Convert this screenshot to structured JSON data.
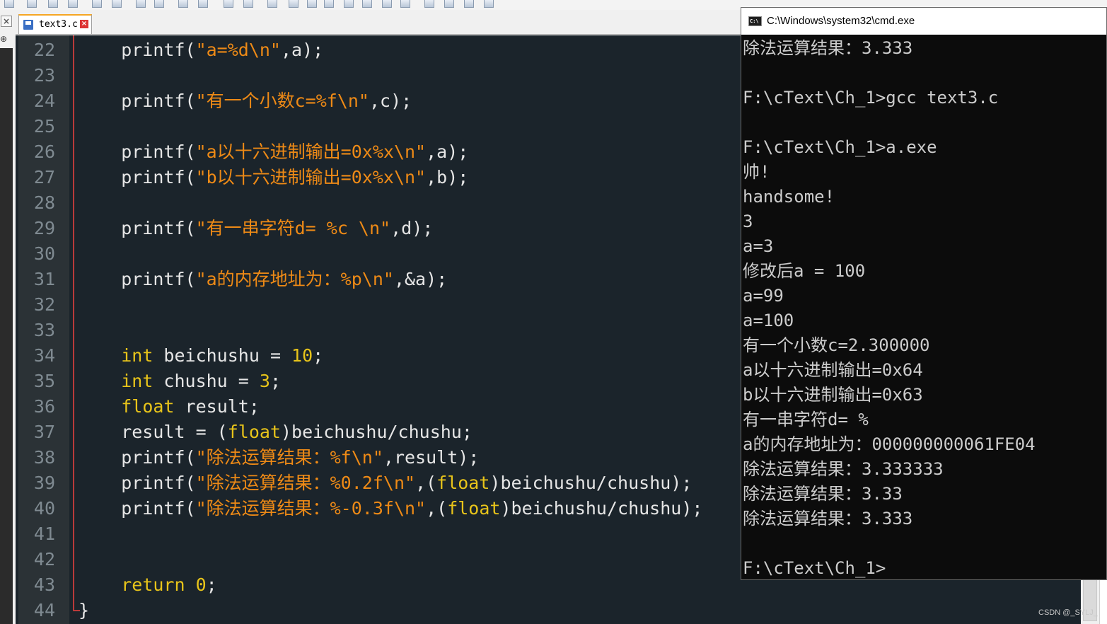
{
  "editor": {
    "tab_label": "text3.c",
    "lines": [
      {
        "num": "22",
        "tokens": [
          {
            "t": "    printf(",
            "c": "t"
          },
          {
            "t": "\"a=%d\\n\"",
            "c": "s"
          },
          {
            "t": ",a);",
            "c": "t"
          }
        ]
      },
      {
        "num": "23",
        "tokens": []
      },
      {
        "num": "24",
        "tokens": [
          {
            "t": "    printf(",
            "c": "t"
          },
          {
            "t": "\"有一个小数c=%f\\n\"",
            "c": "s"
          },
          {
            "t": ",c);",
            "c": "t"
          }
        ]
      },
      {
        "num": "25",
        "tokens": []
      },
      {
        "num": "26",
        "tokens": [
          {
            "t": "    printf(",
            "c": "t"
          },
          {
            "t": "\"a以十六进制输出=0x%x\\n\"",
            "c": "s"
          },
          {
            "t": ",a);",
            "c": "t"
          }
        ]
      },
      {
        "num": "27",
        "tokens": [
          {
            "t": "    printf(",
            "c": "t"
          },
          {
            "t": "\"b以十六进制输出=0x%x\\n\"",
            "c": "s"
          },
          {
            "t": ",b);",
            "c": "t"
          }
        ]
      },
      {
        "num": "28",
        "tokens": []
      },
      {
        "num": "29",
        "tokens": [
          {
            "t": "    printf(",
            "c": "t"
          },
          {
            "t": "\"有一串字符d= %c \\n\"",
            "c": "s"
          },
          {
            "t": ",d);",
            "c": "t"
          }
        ]
      },
      {
        "num": "30",
        "tokens": []
      },
      {
        "num": "31",
        "tokens": [
          {
            "t": "    printf(",
            "c": "t"
          },
          {
            "t": "\"a的内存地址为：%p\\n\"",
            "c": "s"
          },
          {
            "t": ",&a);",
            "c": "t"
          }
        ]
      },
      {
        "num": "32",
        "tokens": []
      },
      {
        "num": "33",
        "tokens": []
      },
      {
        "num": "34",
        "tokens": [
          {
            "t": "    ",
            "c": "t"
          },
          {
            "t": "int",
            "c": "k"
          },
          {
            "t": " beichushu = ",
            "c": "t"
          },
          {
            "t": "10",
            "c": "n"
          },
          {
            "t": ";",
            "c": "t"
          }
        ]
      },
      {
        "num": "35",
        "tokens": [
          {
            "t": "    ",
            "c": "t"
          },
          {
            "t": "int",
            "c": "k"
          },
          {
            "t": " chushu = ",
            "c": "t"
          },
          {
            "t": "3",
            "c": "n"
          },
          {
            "t": ";",
            "c": "t"
          }
        ]
      },
      {
        "num": "36",
        "tokens": [
          {
            "t": "    ",
            "c": "t"
          },
          {
            "t": "float",
            "c": "k"
          },
          {
            "t": " result;",
            "c": "t"
          }
        ]
      },
      {
        "num": "37",
        "tokens": [
          {
            "t": "    result = (",
            "c": "t"
          },
          {
            "t": "float",
            "c": "k"
          },
          {
            "t": ")beichushu/chushu;",
            "c": "t"
          }
        ]
      },
      {
        "num": "38",
        "tokens": [
          {
            "t": "    printf(",
            "c": "t"
          },
          {
            "t": "\"除法运算结果：%f\\n\"",
            "c": "s"
          },
          {
            "t": ",result);",
            "c": "t"
          }
        ]
      },
      {
        "num": "39",
        "tokens": [
          {
            "t": "    printf(",
            "c": "t"
          },
          {
            "t": "\"除法运算结果：%0.2f\\n\"",
            "c": "s"
          },
          {
            "t": ",(",
            "c": "t"
          },
          {
            "t": "float",
            "c": "k"
          },
          {
            "t": ")beichushu/chushu);",
            "c": "t"
          }
        ]
      },
      {
        "num": "40",
        "tokens": [
          {
            "t": "    printf(",
            "c": "t"
          },
          {
            "t": "\"除法运算结果：%-0.3f\\n\"",
            "c": "s"
          },
          {
            "t": ",(",
            "c": "t"
          },
          {
            "t": "float",
            "c": "k"
          },
          {
            "t": ")beichushu/chushu);",
            "c": "t"
          }
        ]
      },
      {
        "num": "41",
        "tokens": []
      },
      {
        "num": "42",
        "tokens": []
      },
      {
        "num": "43",
        "tokens": [
          {
            "t": "    ",
            "c": "t"
          },
          {
            "t": "return",
            "c": "k"
          },
          {
            "t": " ",
            "c": "t"
          },
          {
            "t": "0",
            "c": "n"
          },
          {
            "t": ";",
            "c": "t"
          }
        ]
      },
      {
        "num": "44",
        "tokens": [
          {
            "t": "}",
            "c": "t"
          }
        ],
        "brace": true
      }
    ]
  },
  "cmd": {
    "title": "C:\\Windows\\system32\\cmd.exe",
    "icon_label": "C:\\",
    "lines": [
      "除法运算结果：3.333",
      "",
      "F:\\cText\\Ch_1>gcc text3.c",
      "",
      "F:\\cText\\Ch_1>a.exe",
      "帅!",
      "handsome!",
      "3",
      "a=3",
      "修改后a = 100",
      "a=99",
      "a=100",
      "有一个小数c=2.300000",
      "a以十六进制输出=0x64",
      "b以十六进制输出=0x63",
      "有一串字符d= %",
      "a的内存地址为：000000000061FE04",
      "除法运算结果：3.333333",
      "除法运算结果：3.33",
      "除法运算结果：3.333",
      "",
      "F:\\cText\\Ch_1>"
    ]
  },
  "watermark": "CSDN @_SYLJ_",
  "toolbar_icons": [
    "print-icon",
    "cut-icon",
    "copy-icon",
    "paste-icon",
    "undo-icon",
    "redo-icon",
    "find-icon",
    "replace-icon",
    "zoom-in-icon",
    "zoom-out-icon",
    "sync-v-icon",
    "sync-h-icon",
    "wrap-icon",
    "indent-guide-icon",
    "show-all-icon",
    "doc-map-icon",
    "function-list-icon",
    "folder-icon",
    "monitor-icon",
    "record-icon",
    "stop-icon",
    "play-icon",
    "play-multi-icon",
    "save-macro-icon"
  ],
  "colors": {
    "editor_bg": "#1b242b",
    "gutter_bg": "#2b3236",
    "string": "#ee8a16",
    "keyword": "#e8c41a",
    "text": "#e6e6e6",
    "cmd_bg": "#0c0c0c",
    "cmd_text": "#cccccc"
  }
}
